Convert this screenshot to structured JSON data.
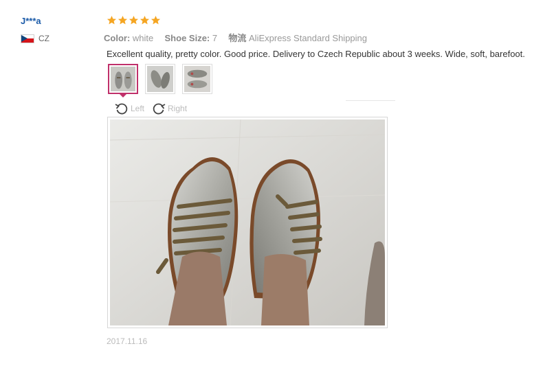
{
  "review": {
    "user_name": "J***a",
    "country_code": "CZ",
    "rating": 5,
    "attributes": [
      {
        "key": "Color:",
        "value": "white"
      },
      {
        "key": "Shoe Size:",
        "value": "7"
      },
      {
        "key": "物流",
        "value": "AliExpress Standard Shipping"
      }
    ],
    "text": "Excellent quality, pretty color. Good price. Delivery to Czech Republic about 3 weeks. Wide, soft, barefoot.",
    "date": "2017.11.16",
    "rotate_left_label": "Left",
    "rotate_right_label": "Right"
  },
  "colors": {
    "star": "#f5a623",
    "active_thumb_border": "#c0306a",
    "username": "#1a5aa8"
  },
  "icons": [
    "star-icon",
    "rotate-left-icon",
    "rotate-right-icon",
    "czech-flag-icon"
  ]
}
